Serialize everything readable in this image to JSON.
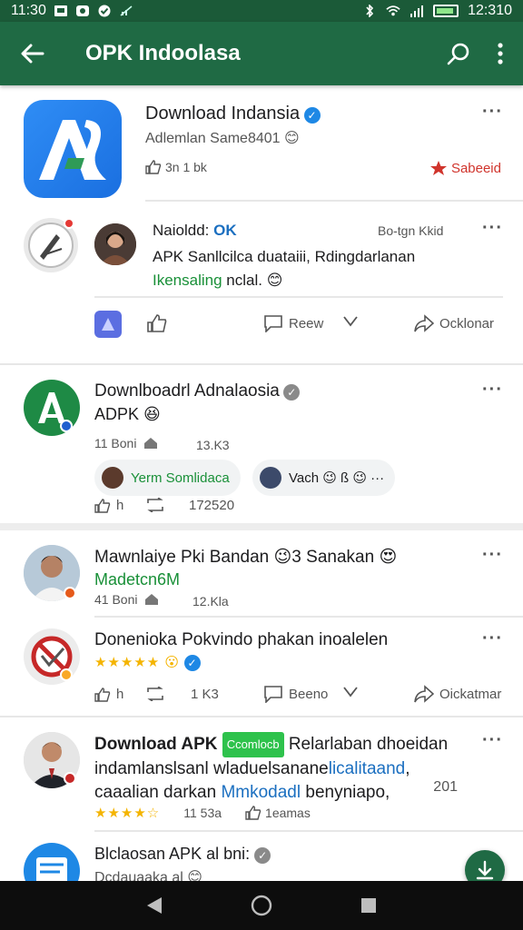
{
  "status_bar": {
    "time_left": "11:30",
    "time_right": "12:310"
  },
  "app_bar": {
    "title": "OPK Indoolasa"
  },
  "colors": {
    "app_bar": "#1f6a44",
    "status_bar": "#1b5a38",
    "accent_blue": "#1e88e5",
    "green_text": "#199038",
    "red_text": "#d0342c"
  },
  "post1": {
    "title": "Download Indansia",
    "subtitle": "Adlemlan Same8401 😊",
    "likes": "3n 1 bk",
    "save_label": "Sabeeid"
  },
  "comment1": {
    "name": "Naioldd: ",
    "ok": "OK",
    "meta": "Bo-tgn Kkid",
    "line1": "APK Sanllcilca duataiii, Rdingdarlanan",
    "line2_green": "Ikensaling",
    "line2_rest": " nclal. 😊",
    "actions": {
      "review": "Reew",
      "share": "Ocklonar"
    }
  },
  "post2": {
    "title": "Downlboadrl Adnalaosia",
    "sub": "ADPK 😆",
    "count": "11 Boni",
    "views": "13.K3",
    "chip1": "Yerm Somlidaca",
    "chip2": "Vach 😉 ß 😉 ···",
    "actions": {
      "like": "h",
      "count": "172520"
    }
  },
  "post3": {
    "title": "Mawnlaiye Pki Bandan 😉3",
    "title_tail": " Sanakan 😍",
    "sub": "Madetcn6M",
    "count": "41 Boni",
    "views": "12.Kla"
  },
  "comment3": {
    "title": "Donenioka Pokvindo phakan inoalelen",
    "stars": "★★★★★ 😮",
    "actions": {
      "like": "h",
      "count": "1 K3",
      "review": "Beeno",
      "share": "Oickatmar"
    }
  },
  "post4": {
    "title_a": "Download APK ",
    "badge": "Ccomlocb",
    "title_b": " Relarlaban dhoeidan",
    "line2a": "indamlanslsanl wladuelsanane",
    "line2b": "licalitaand",
    "line2c": ",",
    "line3a": "caaalian darkan ",
    "line3b": "Mmkodadl",
    "line3c": " benyniapo,",
    "num": "201",
    "stars": "★★★★☆",
    "count": "11 53a",
    "likes": "1eamas"
  },
  "post5": {
    "title": "Blclaosan APK al bni: ",
    "sub": "Dcdauaaka al 😊"
  }
}
